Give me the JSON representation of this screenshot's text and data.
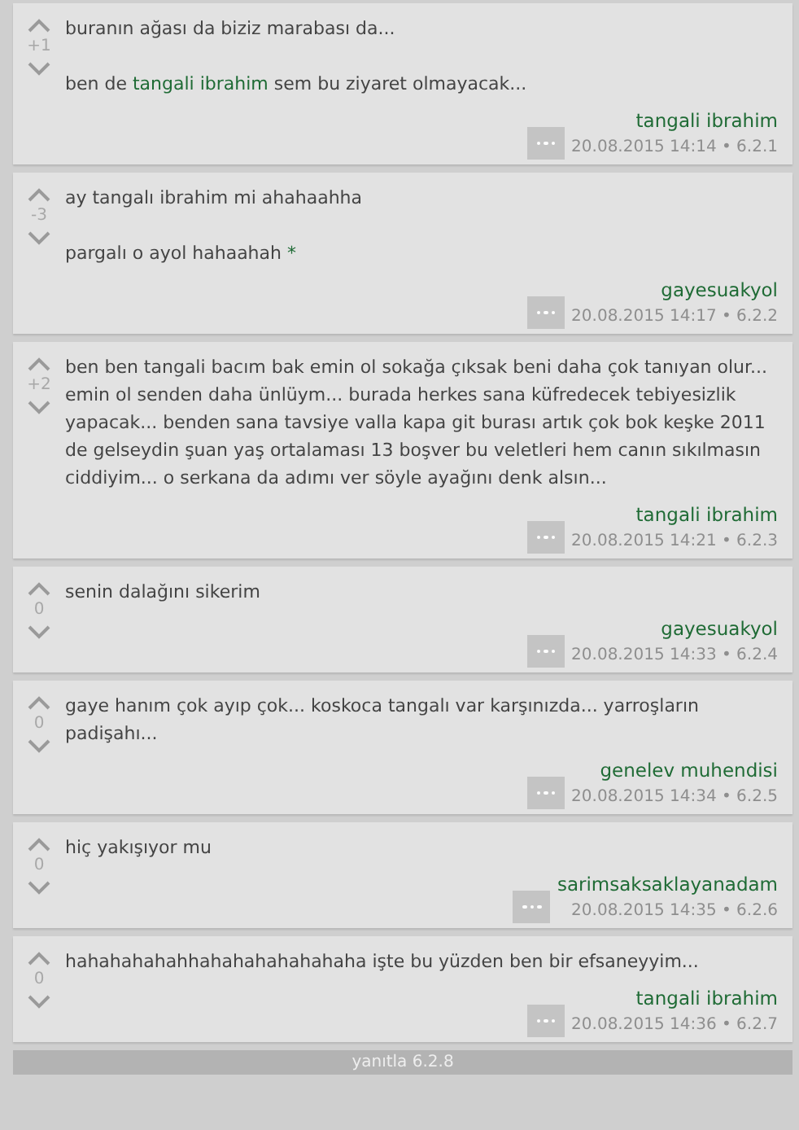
{
  "entries": [
    {
      "score": "+1",
      "paragraphs": [
        [
          {
            "kind": "text",
            "text": "buranın ağası da biziz marabası da..."
          }
        ],
        [
          {
            "kind": "text",
            "text": "ben de "
          },
          {
            "kind": "link",
            "text": "tangali ibrahim"
          },
          {
            "kind": "text",
            "text": " sem bu ziyaret olmayacak..."
          }
        ]
      ],
      "author": "tangali ibrahim",
      "date": "20.08.2015 14:14 • 6.2.1"
    },
    {
      "score": "-3",
      "paragraphs": [
        [
          {
            "kind": "text",
            "text": "ay tangalı ibrahim mi ahahaahha"
          }
        ],
        [
          {
            "kind": "text",
            "text": "pargalı o ayol hahaahah "
          },
          {
            "kind": "link",
            "text": "*"
          }
        ]
      ],
      "author": "gayesuakyol",
      "date": "20.08.2015 14:17 • 6.2.2"
    },
    {
      "score": "+2",
      "paragraphs": [
        [
          {
            "kind": "text",
            "text": "ben ben tangali bacım bak emin ol sokağa çıksak beni daha çok tanıyan olur... emin ol senden daha ünlüym... burada herkes sana küfredecek tebiyesizlik yapacak... benden sana tavsiye valla kapa git burası artık çok bok keşke 2011 de gelseydin şuan yaş ortalaması 13 boşver bu veletleri hem canın sıkılmasın ciddiyim... o serkana da adımı ver söyle ayağını denk alsın..."
          }
        ]
      ],
      "author": "tangali ibrahim",
      "date": "20.08.2015 14:21 • 6.2.3"
    },
    {
      "score": "0",
      "paragraphs": [
        [
          {
            "kind": "text",
            "text": "senin dalağını sikerim"
          }
        ]
      ],
      "author": "gayesuakyol",
      "date": "20.08.2015 14:33 • 6.2.4"
    },
    {
      "score": "0",
      "paragraphs": [
        [
          {
            "kind": "text",
            "text": "gaye hanım çok ayıp çok...  koskoca tangalı var karşınızda...  yarroşların padişahı..."
          }
        ]
      ],
      "author": "genelev muhendisi",
      "date": "20.08.2015 14:34 • 6.2.5"
    },
    {
      "score": "0",
      "paragraphs": [
        [
          {
            "kind": "text",
            "text": "hiç yakışıyor mu"
          }
        ]
      ],
      "author": "sarimsaksaklayanadam",
      "date": "20.08.2015 14:35 • 6.2.6"
    },
    {
      "score": "0",
      "paragraphs": [
        [
          {
            "kind": "text",
            "text": "hahahahahahhahahahahahahaha işte bu yüzden ben bir efsaneyyim..."
          }
        ]
      ],
      "author": "tangali ibrahim",
      "date": "20.08.2015 14:36 • 6.2.7"
    }
  ],
  "reply_bar": {
    "label": "yanıtla 6.2.8"
  }
}
